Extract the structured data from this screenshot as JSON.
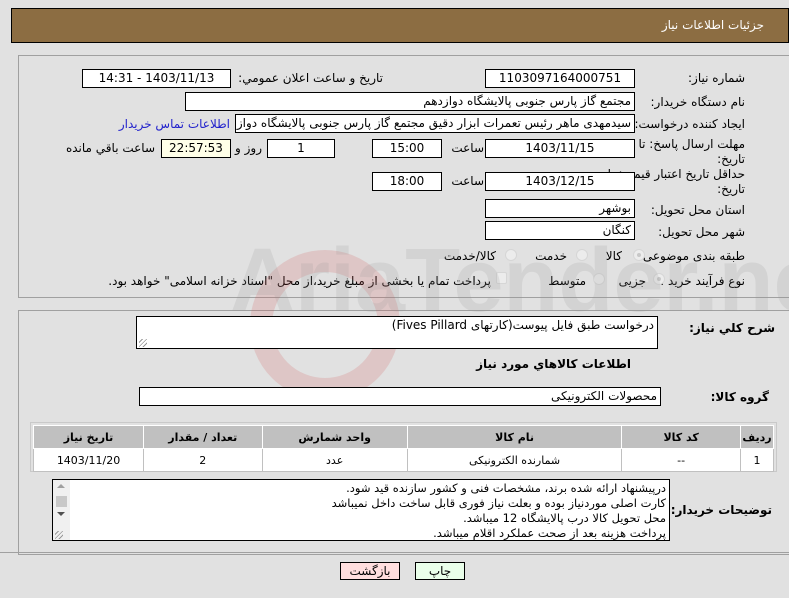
{
  "header": {
    "title": "جزئیات اطلاعات نیاز"
  },
  "form": {
    "need_number_label": "شماره نیاز:",
    "need_number": "1103097164000751",
    "announce_label": "تاریخ و ساعت اعلان عمومي:",
    "announce_value": "1403/11/13 - 14:31",
    "buyer_org_label": "نام دستگاه خریدار:",
    "buyer_org": "مجتمع گاز پارس جنوبی  پالایشگاه دوازدهم",
    "creator_label": "ایجاد کننده درخواست:",
    "creator": "سیدمهدی ماهر رئیس تعمرات ابزار دقیق مجتمع گاز پارس جنوبی  پالایشگاه دواز",
    "contact_link": "اطلاعات تماس خریدار",
    "deadline_label": "مهلت ارسال پاسخ: تا تاریخ:",
    "deadline_date": "1403/11/15",
    "time_label": "ساعت",
    "deadline_time": "15:00",
    "days_value": "1",
    "days_label": "روز و",
    "remaining_time": "22:57:53",
    "remaining_label": "ساعت باقي مانده",
    "validity_label": "حداقل تاریخ اعتبار قیمت: تا تاریخ:",
    "validity_date": "1403/12/15",
    "validity_time": "18:00",
    "province_label": "استان محل تحویل:",
    "province": "بوشهر",
    "city_label": "شهر محل تحویل:",
    "city": "کنگان",
    "category_label": "طبقه بندی موضوعی:",
    "category_options": [
      "کالا",
      "خدمت",
      "کالا/خدمت"
    ],
    "category_selected": "کالا",
    "process_label": "نوع فرآیند خرید :",
    "process_options": [
      "جزیی",
      "متوسط"
    ],
    "process_selected": "جزیی",
    "treasury_text": "پرداخت تمام یا بخشی از مبلغ خرید،از محل \"اسناد خزانه اسلامی\" خواهد بود."
  },
  "details": {
    "description_label": "شرح کلي نیاز:",
    "description": "درخواست طبق فایل پیوست(کارتهای Fives Pillard)",
    "goods_info_title": "اطلاعات کالاهاي مورد نیاز",
    "goods_group_label": "گروه کالا:",
    "goods_group": "محصولات الکترونیکی",
    "table": {
      "headers": [
        "ردیف",
        "کد کالا",
        "نام کالا",
        "واحد شمارش",
        "تعداد / مقدار",
        "تاریخ نیاز"
      ],
      "rows": [
        [
          "1",
          "--",
          "شمارنده الکترونیکی",
          "عدد",
          "2",
          "1403/11/20"
        ]
      ]
    },
    "notes_label": "توضیحات خریدار:",
    "notes": [
      "درپیشنهاد ارائه شده برند، مشخصات فنی و کشور سازنده قید شود.",
      "کارت اصلی موردنیاز بوده و بعلت نیاز فوری قابل ساخت داخل نمیباشد",
      "محل تحویل کالا درب پالایشگاه 12 میباشد.",
      "پرداخت هزینه بعد از صحت عملکرد اقلام میباشد."
    ]
  },
  "buttons": {
    "back": "بازگشت",
    "print": "چاپ"
  },
  "watermark": "AriaTender.neT"
}
